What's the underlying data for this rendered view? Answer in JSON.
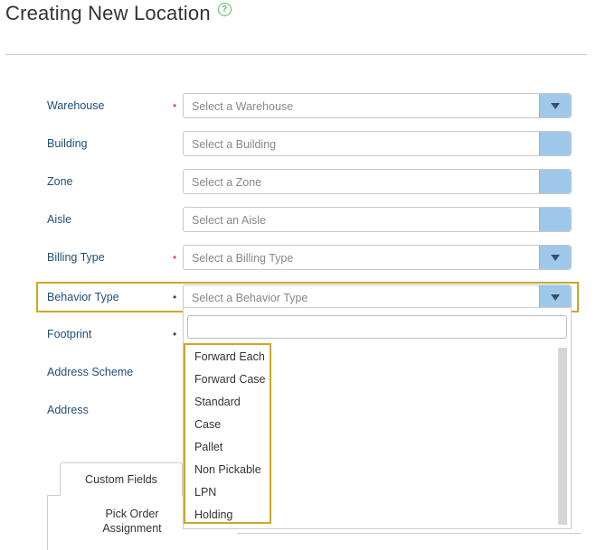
{
  "page": {
    "title": "Creating New Location",
    "help_icon": "question-circle-icon"
  },
  "colors": {
    "label": "#1f4e79",
    "required_red": "#d9534f",
    "required_dark": "#444444",
    "highlight": "#c9a92a",
    "select_button": "#9fc8ea"
  },
  "form": {
    "fields": [
      {
        "label": "Warehouse",
        "required": "•",
        "placeholder": "Select a Warehouse",
        "has_arrow": true
      },
      {
        "label": "Building",
        "required": "",
        "placeholder": "Select a Building",
        "has_arrow": false
      },
      {
        "label": "Zone",
        "required": "",
        "placeholder": "Select a Zone",
        "has_arrow": false
      },
      {
        "label": "Aisle",
        "required": "",
        "placeholder": "Select an Aisle",
        "has_arrow": false
      },
      {
        "label": "Billing Type",
        "required": "•",
        "placeholder": "Select a Billing Type",
        "has_arrow": true
      },
      {
        "label": "Behavior Type",
        "required": "•",
        "placeholder": "Select a Behavior Type",
        "has_arrow": true
      }
    ],
    "hidden_labels": [
      {
        "label": "Footprint",
        "required": "•"
      },
      {
        "label": "Address Scheme",
        "required": ""
      },
      {
        "label": "Address",
        "required": ""
      }
    ]
  },
  "dropdown": {
    "search_value": "",
    "options": [
      "Forward Each",
      "Forward Case",
      "Standard",
      "Case",
      "Pallet",
      "Non Pickable",
      "LPN",
      "Holding"
    ]
  },
  "tabs": {
    "custom_fields": "Custom Fields",
    "pick_order_assignment": "Pick Order Assignment"
  }
}
